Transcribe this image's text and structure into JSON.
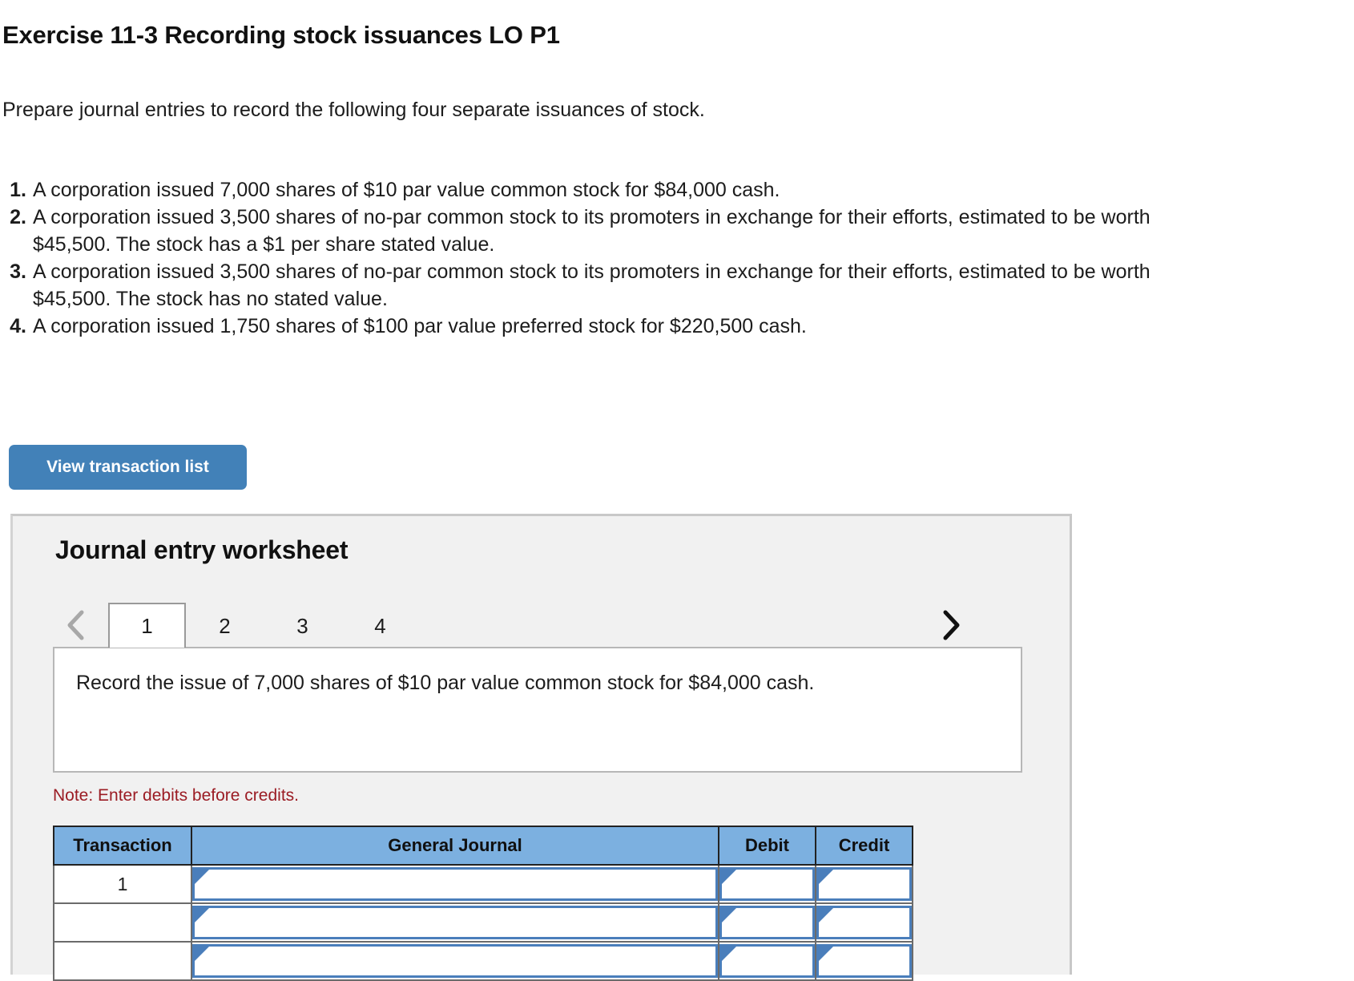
{
  "exercise": {
    "title": "Exercise 11-3 Recording stock issuances LO P1",
    "intro": "Prepare journal entries to record the following four separate issuances of stock.",
    "items": [
      {
        "num": "1.",
        "text": "A corporation issued 7,000 shares of $10 par value common stock for $84,000 cash."
      },
      {
        "num": "2.",
        "text": "A corporation issued 3,500 shares of no-par common stock to its promoters in exchange for their efforts, estimated to be worth $45,500. The stock has a $1 per share stated value."
      },
      {
        "num": "3.",
        "text": "A corporation issued 3,500 shares of no-par common stock to its promoters in exchange for their efforts, estimated to be worth $45,500. The stock has no stated value."
      },
      {
        "num": "4.",
        "text": "A corporation issued 1,750 shares of $100 par value preferred stock for $220,500 cash."
      }
    ]
  },
  "buttons": {
    "view_transaction_list": "View transaction list"
  },
  "worksheet": {
    "title": "Journal entry worksheet",
    "prev_icon": "chevron-left-icon",
    "next_icon": "chevron-right-icon",
    "tabs": [
      {
        "label": "1",
        "active": true
      },
      {
        "label": "2",
        "active": false
      },
      {
        "label": "3",
        "active": false
      },
      {
        "label": "4",
        "active": false
      }
    ],
    "description": "Record the issue of 7,000 shares of $10 par value common stock for $84,000 cash.",
    "note": "Note: Enter debits before credits.",
    "table": {
      "headers": [
        "Transaction",
        "General Journal",
        "Debit",
        "Credit"
      ],
      "rows": [
        {
          "transaction": "1",
          "general_journal": "",
          "debit": "",
          "credit": ""
        },
        {
          "transaction": "",
          "general_journal": "",
          "debit": "",
          "credit": ""
        },
        {
          "transaction": "",
          "general_journal": "",
          "debit": "",
          "credit": ""
        }
      ]
    }
  },
  "colors": {
    "button_blue": "#4281b8",
    "table_header_blue": "#7cb0e0",
    "field_border_blue": "#4a7ebb",
    "note_red": "#9b1c24",
    "panel_gray": "#f1f1f1"
  }
}
